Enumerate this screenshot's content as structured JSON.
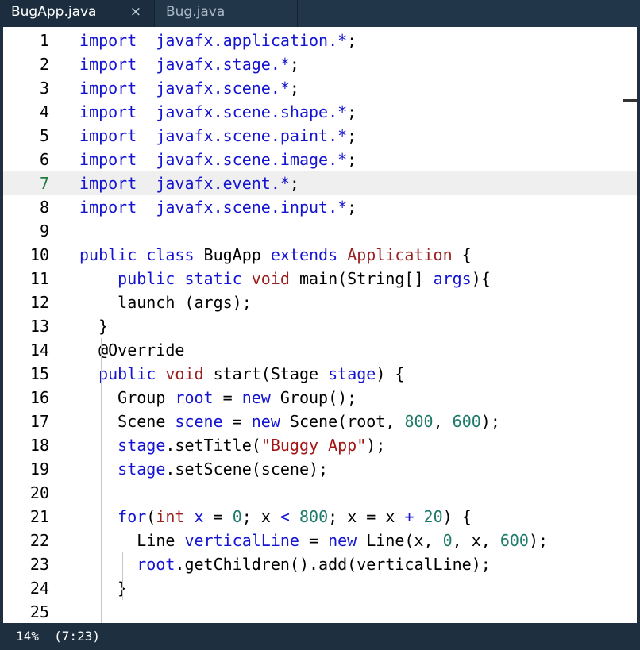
{
  "tabs": [
    {
      "label": "BugApp.java",
      "close": "×",
      "active": true
    },
    {
      "label": "Bug.java",
      "active": false
    }
  ],
  "editor": {
    "current_line": 7,
    "lines": [
      {
        "n": "1",
        "tokens": [
          [
            "kw",
            "import"
          ],
          [
            "",
            "  "
          ],
          [
            "kw",
            "javafx.application.*"
          ],
          [
            "",
            ";"
          ]
        ]
      },
      {
        "n": "2",
        "tokens": [
          [
            "kw",
            "import"
          ],
          [
            "",
            "  "
          ],
          [
            "kw",
            "javafx.stage.*"
          ],
          [
            "",
            ";"
          ]
        ]
      },
      {
        "n": "3",
        "tokens": [
          [
            "kw",
            "import"
          ],
          [
            "",
            "  "
          ],
          [
            "kw",
            "javafx.scene.*"
          ],
          [
            "",
            ";"
          ]
        ]
      },
      {
        "n": "4",
        "tokens": [
          [
            "kw",
            "import"
          ],
          [
            "",
            "  "
          ],
          [
            "kw",
            "javafx.scene.shape.*"
          ],
          [
            "",
            ";"
          ]
        ]
      },
      {
        "n": "5",
        "tokens": [
          [
            "kw",
            "import"
          ],
          [
            "",
            "  "
          ],
          [
            "kw",
            "javafx.scene.paint.*"
          ],
          [
            "",
            ";"
          ]
        ]
      },
      {
        "n": "6",
        "tokens": [
          [
            "kw",
            "import"
          ],
          [
            "",
            "  "
          ],
          [
            "kw",
            "javafx.scene.image.*"
          ],
          [
            "",
            ";"
          ]
        ]
      },
      {
        "n": "7",
        "tokens": [
          [
            "kw",
            "import"
          ],
          [
            "",
            "  "
          ],
          [
            "kw",
            "javafx.event.*"
          ],
          [
            "",
            ";"
          ]
        ]
      },
      {
        "n": "8",
        "tokens": [
          [
            "kw",
            "import"
          ],
          [
            "",
            "  "
          ],
          [
            "kw",
            "javafx.scene.input.*"
          ],
          [
            "",
            ";"
          ]
        ]
      },
      {
        "n": "9",
        "tokens": []
      },
      {
        "n": "10",
        "tokens": [
          [
            "kw",
            "public"
          ],
          [
            "",
            " "
          ],
          [
            "kw",
            "class"
          ],
          [
            "",
            " BugApp "
          ],
          [
            "kw",
            "extends"
          ],
          [
            "",
            " "
          ],
          [
            "ty",
            "Application"
          ],
          [
            "",
            " {"
          ]
        ]
      },
      {
        "n": "11",
        "tokens": [
          [
            "",
            "    "
          ],
          [
            "kw",
            "public"
          ],
          [
            "",
            " "
          ],
          [
            "kw",
            "static"
          ],
          [
            "",
            " "
          ],
          [
            "ty",
            "void"
          ],
          [
            "",
            " main(String[] "
          ],
          [
            "kw",
            "args"
          ],
          [
            "",
            "){"
          ]
        ]
      },
      {
        "n": "12",
        "tokens": [
          [
            "",
            "    launch (args);"
          ]
        ]
      },
      {
        "n": "13",
        "tokens": [
          [
            "",
            "  }"
          ]
        ]
      },
      {
        "n": "14",
        "tokens": [
          [
            "",
            "  @Override"
          ]
        ]
      },
      {
        "n": "15",
        "tokens": [
          [
            "",
            "  "
          ],
          [
            "kw",
            "public"
          ],
          [
            "",
            " "
          ],
          [
            "ty",
            "void"
          ],
          [
            "",
            " start(Stage "
          ],
          [
            "kw",
            "stage"
          ],
          [
            "",
            ") {"
          ]
        ]
      },
      {
        "n": "16",
        "tokens": [
          [
            "",
            "    Group "
          ],
          [
            "kw",
            "root"
          ],
          [
            "",
            " = "
          ],
          [
            "kw",
            "new"
          ],
          [
            "",
            " Group();"
          ]
        ]
      },
      {
        "n": "17",
        "tokens": [
          [
            "",
            "    Scene "
          ],
          [
            "kw",
            "scene"
          ],
          [
            "",
            " = "
          ],
          [
            "kw",
            "new"
          ],
          [
            "",
            " Scene(root, "
          ],
          [
            "nu",
            "800"
          ],
          [
            "",
            ", "
          ],
          [
            "nu",
            "600"
          ],
          [
            "",
            ");"
          ]
        ]
      },
      {
        "n": "18",
        "tokens": [
          [
            "",
            "    "
          ],
          [
            "kw",
            "stage"
          ],
          [
            "",
            ".setTitle("
          ],
          [
            "st",
            "\"Buggy App\""
          ],
          [
            "",
            ");"
          ]
        ]
      },
      {
        "n": "19",
        "tokens": [
          [
            "",
            "    "
          ],
          [
            "kw",
            "stage"
          ],
          [
            "",
            ".setScene(scene);"
          ]
        ]
      },
      {
        "n": "20",
        "tokens": []
      },
      {
        "n": "21",
        "tokens": [
          [
            "",
            "    "
          ],
          [
            "kw",
            "for"
          ],
          [
            "",
            "("
          ],
          [
            "ty",
            "int"
          ],
          [
            "",
            " "
          ],
          [
            "kw",
            "x"
          ],
          [
            "",
            " = "
          ],
          [
            "nu",
            "0"
          ],
          [
            "",
            "; x "
          ],
          [
            "kw",
            "<"
          ],
          [
            "",
            " "
          ],
          [
            "nu",
            "800"
          ],
          [
            "",
            "; x = x "
          ],
          [
            "kw",
            "+"
          ],
          [
            "",
            " "
          ],
          [
            "nu",
            "20"
          ],
          [
            "",
            ") {"
          ]
        ]
      },
      {
        "n": "22",
        "tokens": [
          [
            "",
            "      Line "
          ],
          [
            "kw",
            "verticalLine"
          ],
          [
            "",
            " = "
          ],
          [
            "kw",
            "new"
          ],
          [
            "",
            " Line(x, "
          ],
          [
            "nu",
            "0"
          ],
          [
            "",
            ", x, "
          ],
          [
            "nu",
            "600"
          ],
          [
            "",
            ");"
          ]
        ]
      },
      {
        "n": "23",
        "tokens": [
          [
            "",
            "      "
          ],
          [
            "kw",
            "root"
          ],
          [
            "",
            ".getChildren().add(verticalLine);"
          ]
        ]
      },
      {
        "n": "24",
        "tokens": [
          [
            "",
            "    }"
          ]
        ]
      },
      {
        "n": "25",
        "tokens": []
      }
    ]
  },
  "status": {
    "text": "14%  (7:23)"
  },
  "colors": {
    "keyword": "#1414d2",
    "type": "#9b1f1f",
    "number": "#1e7a6a",
    "string": "#a31515",
    "chrome": "#1e2f3f"
  }
}
